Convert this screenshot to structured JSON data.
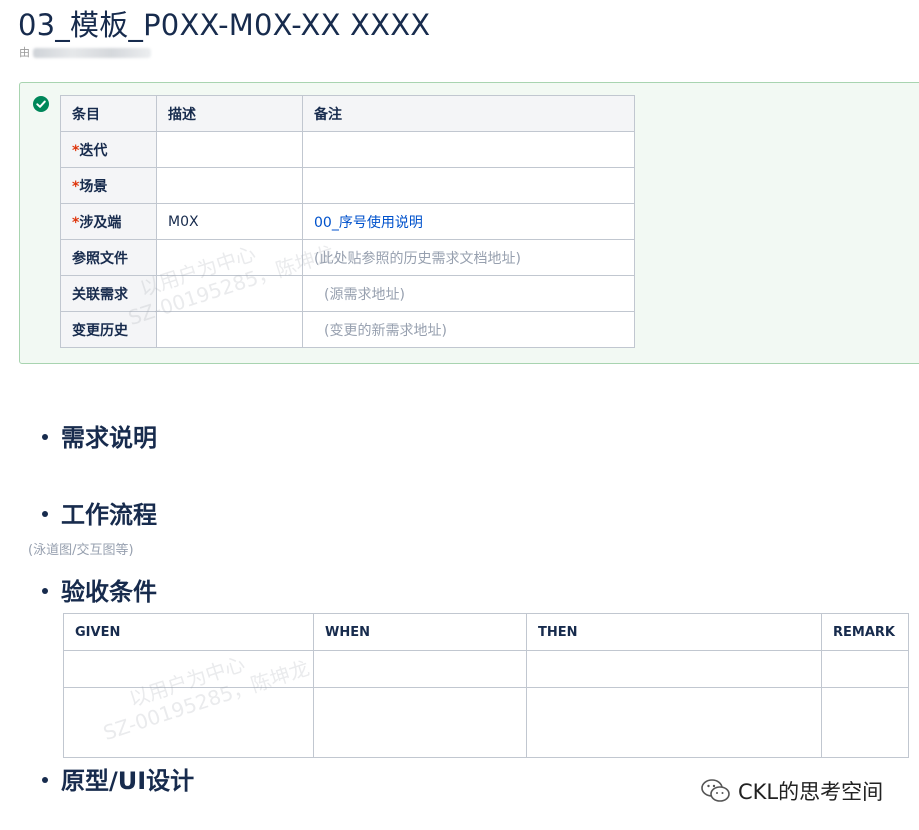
{
  "page": {
    "title": "03_模板_P0XX-M0X-XX XXXX",
    "byline": "由"
  },
  "info_panel": {
    "icon": "check-circle-icon",
    "accent_color": "#00875a",
    "headers": [
      "条目",
      "描述",
      "备注"
    ],
    "rows": [
      {
        "required": true,
        "label": "迭代",
        "desc": "",
        "note": ""
      },
      {
        "required": true,
        "label": "场景",
        "desc": "",
        "note": ""
      },
      {
        "required": true,
        "label": "涉及端",
        "desc": "M0X",
        "note": "00_序号使用说明"
      },
      {
        "required": false,
        "label": "参照文件",
        "desc": "",
        "note": "(此处贴参照的历史需求文档地址)"
      },
      {
        "required": false,
        "label": "关联需求",
        "desc": "",
        "note": "(源需求地址)"
      },
      {
        "required": false,
        "label": "变更历史",
        "desc": "",
        "note": "(变更的新需求地址)"
      }
    ],
    "required_mark": "*"
  },
  "sections": {
    "requirements": "需求说明",
    "workflow": "工作流程",
    "workflow_note": "(泳道图/交互图等)",
    "acceptance": "验收条件",
    "prototype": "原型/UI设计"
  },
  "acceptance_table": {
    "headers": [
      "GIVEN",
      "WHEN",
      "THEN",
      "REMARK"
    ],
    "rows": [
      [
        "",
        "",
        "",
        ""
      ],
      [
        "",
        "",
        "",
        ""
      ]
    ]
  },
  "watermark": {
    "line1": "以用户为中心",
    "line2": "SZ-00195285，陈坤龙"
  },
  "brand": {
    "icon": "wechat-icon",
    "text": "CKL的思考空间"
  }
}
